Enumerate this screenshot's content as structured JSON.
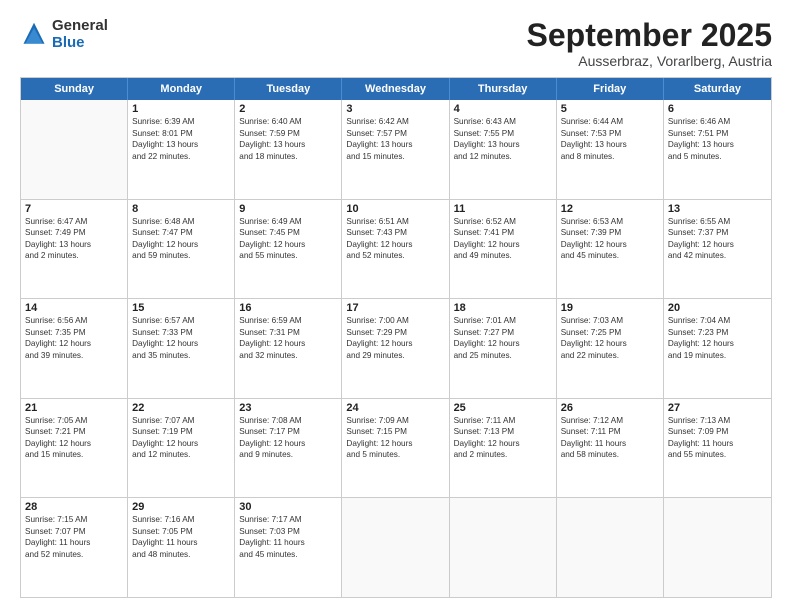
{
  "logo": {
    "general": "General",
    "blue": "Blue"
  },
  "title": "September 2025",
  "location": "Ausserbraz, Vorarlberg, Austria",
  "headers": [
    "Sunday",
    "Monday",
    "Tuesday",
    "Wednesday",
    "Thursday",
    "Friday",
    "Saturday"
  ],
  "rows": [
    [
      {
        "day": "",
        "lines": [],
        "empty": true
      },
      {
        "day": "1",
        "lines": [
          "Sunrise: 6:39 AM",
          "Sunset: 8:01 PM",
          "Daylight: 13 hours",
          "and 22 minutes."
        ]
      },
      {
        "day": "2",
        "lines": [
          "Sunrise: 6:40 AM",
          "Sunset: 7:59 PM",
          "Daylight: 13 hours",
          "and 18 minutes."
        ]
      },
      {
        "day": "3",
        "lines": [
          "Sunrise: 6:42 AM",
          "Sunset: 7:57 PM",
          "Daylight: 13 hours",
          "and 15 minutes."
        ]
      },
      {
        "day": "4",
        "lines": [
          "Sunrise: 6:43 AM",
          "Sunset: 7:55 PM",
          "Daylight: 13 hours",
          "and 12 minutes."
        ]
      },
      {
        "day": "5",
        "lines": [
          "Sunrise: 6:44 AM",
          "Sunset: 7:53 PM",
          "Daylight: 13 hours",
          "and 8 minutes."
        ]
      },
      {
        "day": "6",
        "lines": [
          "Sunrise: 6:46 AM",
          "Sunset: 7:51 PM",
          "Daylight: 13 hours",
          "and 5 minutes."
        ]
      }
    ],
    [
      {
        "day": "7",
        "lines": [
          "Sunrise: 6:47 AM",
          "Sunset: 7:49 PM",
          "Daylight: 13 hours",
          "and 2 minutes."
        ]
      },
      {
        "day": "8",
        "lines": [
          "Sunrise: 6:48 AM",
          "Sunset: 7:47 PM",
          "Daylight: 12 hours",
          "and 59 minutes."
        ]
      },
      {
        "day": "9",
        "lines": [
          "Sunrise: 6:49 AM",
          "Sunset: 7:45 PM",
          "Daylight: 12 hours",
          "and 55 minutes."
        ]
      },
      {
        "day": "10",
        "lines": [
          "Sunrise: 6:51 AM",
          "Sunset: 7:43 PM",
          "Daylight: 12 hours",
          "and 52 minutes."
        ]
      },
      {
        "day": "11",
        "lines": [
          "Sunrise: 6:52 AM",
          "Sunset: 7:41 PM",
          "Daylight: 12 hours",
          "and 49 minutes."
        ]
      },
      {
        "day": "12",
        "lines": [
          "Sunrise: 6:53 AM",
          "Sunset: 7:39 PM",
          "Daylight: 12 hours",
          "and 45 minutes."
        ]
      },
      {
        "day": "13",
        "lines": [
          "Sunrise: 6:55 AM",
          "Sunset: 7:37 PM",
          "Daylight: 12 hours",
          "and 42 minutes."
        ]
      }
    ],
    [
      {
        "day": "14",
        "lines": [
          "Sunrise: 6:56 AM",
          "Sunset: 7:35 PM",
          "Daylight: 12 hours",
          "and 39 minutes."
        ]
      },
      {
        "day": "15",
        "lines": [
          "Sunrise: 6:57 AM",
          "Sunset: 7:33 PM",
          "Daylight: 12 hours",
          "and 35 minutes."
        ]
      },
      {
        "day": "16",
        "lines": [
          "Sunrise: 6:59 AM",
          "Sunset: 7:31 PM",
          "Daylight: 12 hours",
          "and 32 minutes."
        ]
      },
      {
        "day": "17",
        "lines": [
          "Sunrise: 7:00 AM",
          "Sunset: 7:29 PM",
          "Daylight: 12 hours",
          "and 29 minutes."
        ]
      },
      {
        "day": "18",
        "lines": [
          "Sunrise: 7:01 AM",
          "Sunset: 7:27 PM",
          "Daylight: 12 hours",
          "and 25 minutes."
        ]
      },
      {
        "day": "19",
        "lines": [
          "Sunrise: 7:03 AM",
          "Sunset: 7:25 PM",
          "Daylight: 12 hours",
          "and 22 minutes."
        ]
      },
      {
        "day": "20",
        "lines": [
          "Sunrise: 7:04 AM",
          "Sunset: 7:23 PM",
          "Daylight: 12 hours",
          "and 19 minutes."
        ]
      }
    ],
    [
      {
        "day": "21",
        "lines": [
          "Sunrise: 7:05 AM",
          "Sunset: 7:21 PM",
          "Daylight: 12 hours",
          "and 15 minutes."
        ]
      },
      {
        "day": "22",
        "lines": [
          "Sunrise: 7:07 AM",
          "Sunset: 7:19 PM",
          "Daylight: 12 hours",
          "and 12 minutes."
        ]
      },
      {
        "day": "23",
        "lines": [
          "Sunrise: 7:08 AM",
          "Sunset: 7:17 PM",
          "Daylight: 12 hours",
          "and 9 minutes."
        ]
      },
      {
        "day": "24",
        "lines": [
          "Sunrise: 7:09 AM",
          "Sunset: 7:15 PM",
          "Daylight: 12 hours",
          "and 5 minutes."
        ]
      },
      {
        "day": "25",
        "lines": [
          "Sunrise: 7:11 AM",
          "Sunset: 7:13 PM",
          "Daylight: 12 hours",
          "and 2 minutes."
        ]
      },
      {
        "day": "26",
        "lines": [
          "Sunrise: 7:12 AM",
          "Sunset: 7:11 PM",
          "Daylight: 11 hours",
          "and 58 minutes."
        ]
      },
      {
        "day": "27",
        "lines": [
          "Sunrise: 7:13 AM",
          "Sunset: 7:09 PM",
          "Daylight: 11 hours",
          "and 55 minutes."
        ]
      }
    ],
    [
      {
        "day": "28",
        "lines": [
          "Sunrise: 7:15 AM",
          "Sunset: 7:07 PM",
          "Daylight: 11 hours",
          "and 52 minutes."
        ]
      },
      {
        "day": "29",
        "lines": [
          "Sunrise: 7:16 AM",
          "Sunset: 7:05 PM",
          "Daylight: 11 hours",
          "and 48 minutes."
        ]
      },
      {
        "day": "30",
        "lines": [
          "Sunrise: 7:17 AM",
          "Sunset: 7:03 PM",
          "Daylight: 11 hours",
          "and 45 minutes."
        ]
      },
      {
        "day": "",
        "lines": [],
        "empty": true
      },
      {
        "day": "",
        "lines": [],
        "empty": true
      },
      {
        "day": "",
        "lines": [],
        "empty": true
      },
      {
        "day": "",
        "lines": [],
        "empty": true
      }
    ]
  ]
}
